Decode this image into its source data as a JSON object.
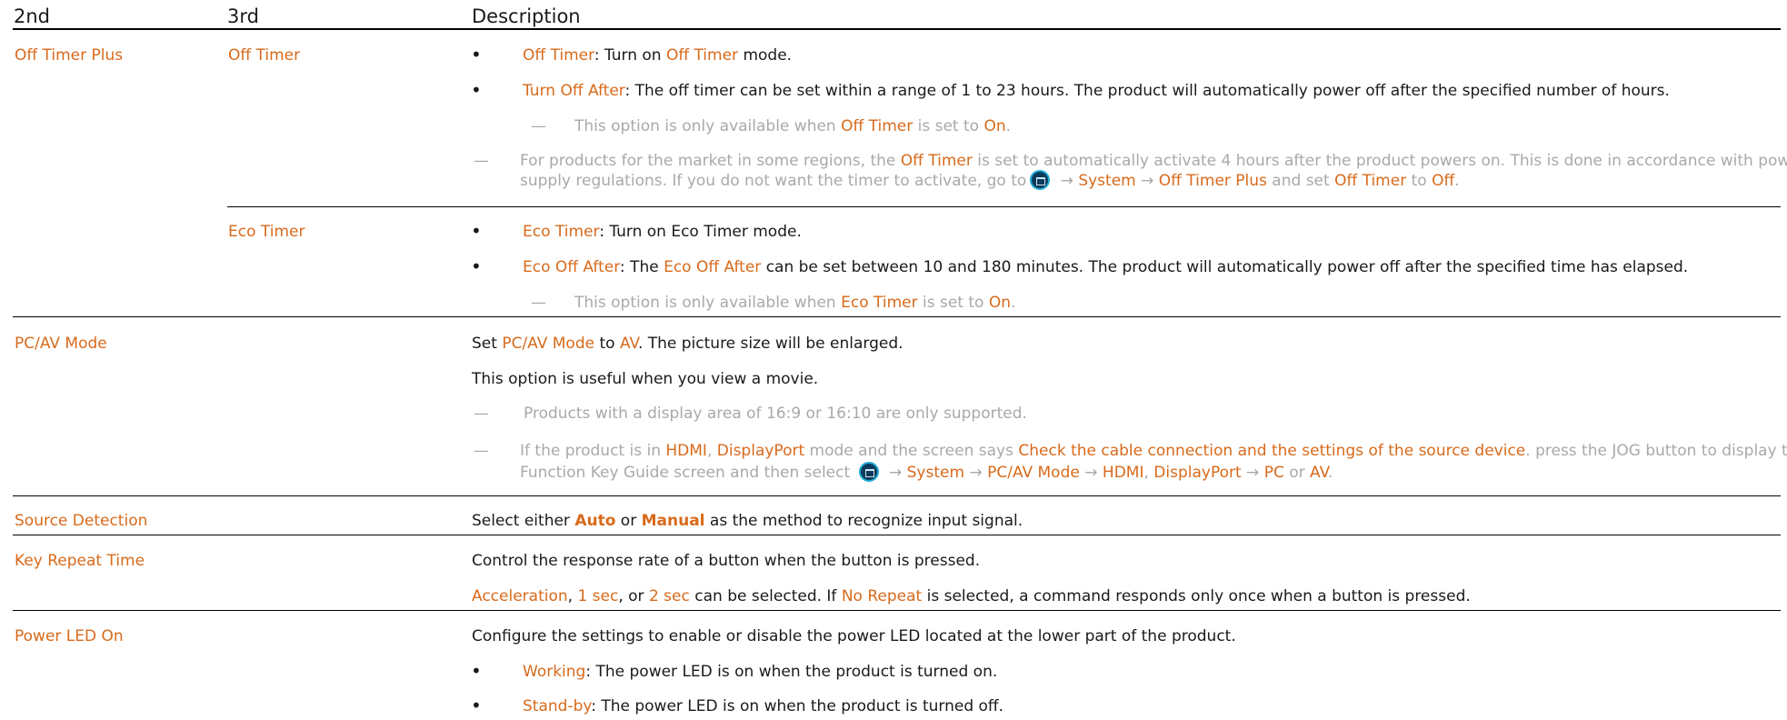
{
  "header": {
    "col2": "2nd",
    "col3": "3rd",
    "col4": "Description"
  },
  "rows": {
    "off_timer_plus": {
      "label": "Off Timer Plus",
      "off_timer": {
        "label": "Off Timer",
        "b1": {
          "t1": "Off Timer",
          "t2": ": Turn on ",
          "t3": "Off Timer",
          "t4": " mode."
        },
        "b2": {
          "t1": "Turn Off After",
          "t2": ": The off timer can be set within a range of 1 to 23 hours. The product will automatically power off after the specified number of hours."
        },
        "n1": {
          "t1": "This option is only available when ",
          "t2": "Off Timer",
          "t3": " is set to ",
          "t4": "On",
          "t5": "."
        },
        "n2": {
          "line1": {
            "t1": "For products for the market in some regions, the ",
            "t2": "Off Timer",
            "t3": " is set to automatically activate 4 hours after the product powers on. This is done in accordance with power"
          },
          "line2": {
            "t1": "supply regulations. If you do not want the timer to activate, go to",
            "t2": " → ",
            "t3": "System",
            "t4": " → ",
            "t5": "Off Timer Plus",
            "t6": " and set ",
            "t7": "Off Timer",
            "t8": " to ",
            "t9": "Off",
            "t10": "."
          }
        }
      },
      "eco_timer": {
        "label": "Eco Timer",
        "b1": {
          "t1": "Eco Timer",
          "t2": ": Turn on Eco Timer mode."
        },
        "b2": {
          "t1": "Eco Off After",
          "t2": ": The ",
          "t3": "Eco Off After",
          "t4": " can be set between 10 and 180 minutes. The product will automatically power off after the specified time has elapsed."
        },
        "n1": {
          "t1": "This option is only available when ",
          "t2": "Eco Timer",
          "t3": " is set to ",
          "t4": "On",
          "t5": "."
        }
      }
    },
    "pcav": {
      "label": "PC/AV Mode",
      "p1": {
        "t1": "Set ",
        "t2": "PC/AV Mode",
        "t3": " to ",
        "t4": "AV",
        "t5": ". The picture size will be enlarged."
      },
      "p2": "This option is useful when you view a movie.",
      "n1": "Products with a display area of 16:9 or 16:10 are only supported.",
      "n2": {
        "line1": {
          "t1": "If the product is in ",
          "t2": "HDMI",
          "t3": ", ",
          "t4": "DisplayPort",
          "t5": " mode and the screen says ",
          "t6": "Check the cable connection and the settings of the source device",
          "t7": ". press the JOG button to display the"
        },
        "line2": {
          "t1": "Function Key Guide screen and then select ",
          "t2": " → ",
          "t3": "System",
          "t4": " → ",
          "t5": "PC/AV Mode",
          "t6": " → ",
          "t7": "HDMI",
          "t8": ", ",
          "t9": "DisplayPort",
          "t10": " → ",
          "t11": "PC",
          "t12": " or ",
          "t13": "AV",
          "t14": "."
        }
      }
    },
    "source": {
      "label": "Source Detection",
      "p1": {
        "t1": "Select either ",
        "t2": "Auto",
        "t3": " or ",
        "t4": "Manual",
        "t5": " as the method to recognize input signal."
      }
    },
    "key_repeat": {
      "label": "Key Repeat Time",
      "p1": "Control the response rate of a button when the button is pressed.",
      "p2": {
        "t1": "Acceleration",
        "t2": ", ",
        "t3": "1 sec",
        "t4": ", or ",
        "t5": "2 sec",
        "t6": " can be selected. If ",
        "t7": "No Repeat",
        "t8": " is selected, a command responds only once when a button is pressed."
      }
    },
    "power_led": {
      "label": "Power LED On",
      "p1": "Configure the settings to enable or disable the power LED located at the lower part of the product.",
      "b1": {
        "t1": "Working",
        "t2": ": The power LED is on when the product is turned on."
      },
      "b2": {
        "t1": "Stand-by",
        "t2": ": The power LED is on when the product is turned off."
      }
    }
  },
  "symbols": {
    "bullet": "•",
    "dash": "—"
  },
  "icons": {
    "menu": "menu-icon"
  },
  "colors": {
    "accent": "#d86a1b",
    "note": "#a9a9a9",
    "text": "#1a1a1a"
  }
}
